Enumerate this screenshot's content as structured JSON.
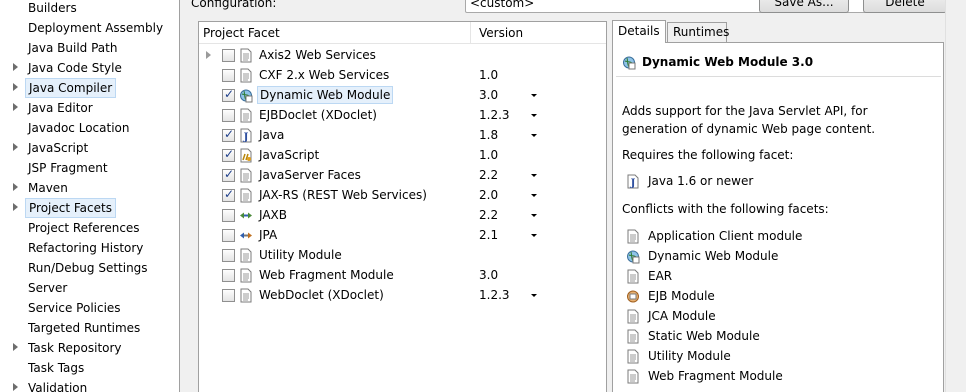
{
  "nav": {
    "items": [
      {
        "label": "Builders",
        "expandable": false,
        "selected": false
      },
      {
        "label": "Deployment Assembly",
        "expandable": false,
        "selected": false
      },
      {
        "label": "Java Build Path",
        "expandable": false,
        "selected": false
      },
      {
        "label": "Java Code Style",
        "expandable": true,
        "selected": false
      },
      {
        "label": "Java Compiler",
        "expandable": true,
        "selected": true
      },
      {
        "label": "Java Editor",
        "expandable": true,
        "selected": false
      },
      {
        "label": "Javadoc Location",
        "expandable": false,
        "selected": false
      },
      {
        "label": "JavaScript",
        "expandable": true,
        "selected": false
      },
      {
        "label": "JSP Fragment",
        "expandable": false,
        "selected": false
      },
      {
        "label": "Maven",
        "expandable": true,
        "selected": false
      },
      {
        "label": "Project Facets",
        "expandable": true,
        "selected": true
      },
      {
        "label": "Project References",
        "expandable": false,
        "selected": false
      },
      {
        "label": "Refactoring History",
        "expandable": false,
        "selected": false
      },
      {
        "label": "Run/Debug Settings",
        "expandable": false,
        "selected": false
      },
      {
        "label": "Server",
        "expandable": false,
        "selected": false
      },
      {
        "label": "Service Policies",
        "expandable": false,
        "selected": false
      },
      {
        "label": "Targeted Runtimes",
        "expandable": false,
        "selected": false
      },
      {
        "label": "Task Repository",
        "expandable": true,
        "selected": false
      },
      {
        "label": "Task Tags",
        "expandable": false,
        "selected": false
      },
      {
        "label": "Validation",
        "expandable": true,
        "selected": false
      }
    ]
  },
  "config": {
    "label": "Configuration:",
    "value": "<custom>",
    "save_as_label": "Save As...",
    "delete_label": "Delete"
  },
  "table": {
    "col_facet": "Project Facet",
    "col_version": "Version",
    "rows": [
      {
        "name": "Axis2 Web Services",
        "version": "",
        "checked": false,
        "expandable": true,
        "dropdown": false,
        "icon": "document-icon",
        "selected": false
      },
      {
        "name": "CXF 2.x Web Services",
        "version": "1.0",
        "checked": false,
        "expandable": false,
        "dropdown": false,
        "icon": "document-icon",
        "selected": false
      },
      {
        "name": "Dynamic Web Module",
        "version": "3.0",
        "checked": true,
        "expandable": false,
        "dropdown": true,
        "icon": "web-module-icon",
        "selected": true
      },
      {
        "name": "EJBDoclet (XDoclet)",
        "version": "1.2.3",
        "checked": false,
        "expandable": false,
        "dropdown": true,
        "icon": "document-icon",
        "selected": false
      },
      {
        "name": "Java",
        "version": "1.8",
        "checked": true,
        "expandable": false,
        "dropdown": true,
        "icon": "java-icon",
        "selected": false
      },
      {
        "name": "JavaScript",
        "version": "1.0",
        "checked": true,
        "expandable": false,
        "dropdown": false,
        "icon": "javascript-icon",
        "selected": false
      },
      {
        "name": "JavaServer Faces",
        "version": "2.2",
        "checked": true,
        "expandable": false,
        "dropdown": true,
        "icon": "document-icon",
        "selected": false
      },
      {
        "name": "JAX-RS (REST Web Services)",
        "version": "2.0",
        "checked": true,
        "expandable": false,
        "dropdown": true,
        "icon": "document-icon",
        "selected": false
      },
      {
        "name": "JAXB",
        "version": "2.2",
        "checked": false,
        "expandable": false,
        "dropdown": true,
        "icon": "jaxb-icon",
        "selected": false
      },
      {
        "name": "JPA",
        "version": "2.1",
        "checked": false,
        "expandable": false,
        "dropdown": true,
        "icon": "jpa-icon",
        "selected": false
      },
      {
        "name": "Utility Module",
        "version": "",
        "checked": false,
        "expandable": false,
        "dropdown": false,
        "icon": "document-icon",
        "selected": false
      },
      {
        "name": "Web Fragment Module",
        "version": "3.0",
        "checked": false,
        "expandable": false,
        "dropdown": false,
        "icon": "document-icon",
        "selected": false
      },
      {
        "name": "WebDoclet (XDoclet)",
        "version": "1.2.3",
        "checked": false,
        "expandable": false,
        "dropdown": true,
        "icon": "document-icon",
        "selected": false
      }
    ]
  },
  "details": {
    "tab_details": "Details",
    "tab_runtimes": "Runtimes",
    "title": "Dynamic Web Module 3.0",
    "description_line1": "Adds support for the Java Servlet API, for",
    "description_line2": "generation of dynamic Web page content.",
    "requires_label": "Requires the following facet:",
    "requires": [
      {
        "label": "Java 1.6 or newer",
        "icon": "java-icon"
      }
    ],
    "conflicts_label": "Conflicts with the following facets:",
    "conflicts": [
      {
        "label": "Application Client module",
        "icon": "document-icon"
      },
      {
        "label": "Dynamic Web Module",
        "icon": "web-module-icon"
      },
      {
        "label": "EAR",
        "icon": "document-icon"
      },
      {
        "label": "EJB Module",
        "icon": "ejb-icon"
      },
      {
        "label": "JCA Module",
        "icon": "document-icon"
      },
      {
        "label": "Static Web Module",
        "icon": "document-icon"
      },
      {
        "label": "Utility Module",
        "icon": "document-icon"
      },
      {
        "label": "Web Fragment Module",
        "icon": "document-icon"
      }
    ]
  },
  "colors": {
    "selection_bg": "#e5f0fb",
    "selection_border": "#bcd8f3",
    "panel_bg": "#ffffff",
    "window_bg": "#f0f0f0"
  }
}
